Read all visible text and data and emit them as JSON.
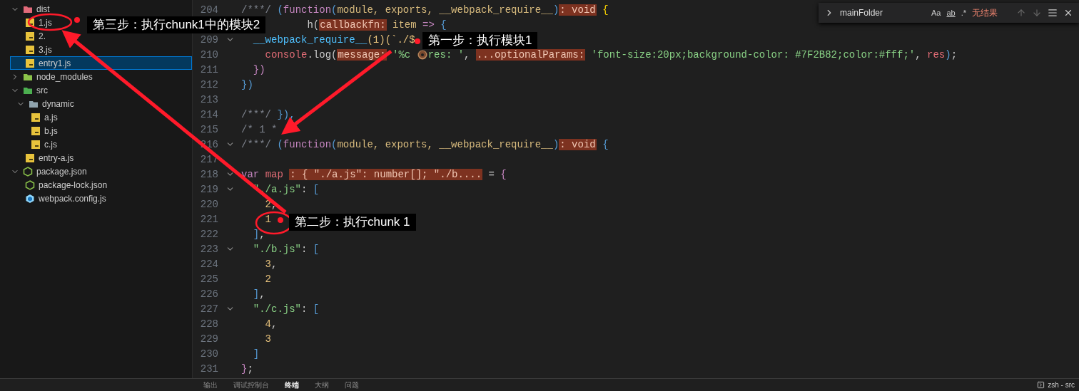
{
  "explorer": {
    "items": [
      {
        "name": "dist",
        "kind": "folder-dist",
        "expanded": true,
        "selected": false,
        "children": [
          {
            "name": "1.js",
            "kind": "js",
            "selected": false
          },
          {
            "name": "2.",
            "kind": "js",
            "selected": false
          },
          {
            "name": "3.js",
            "kind": "js",
            "selected": false
          },
          {
            "name": "entry1.js",
            "kind": "js",
            "selected": true
          }
        ]
      },
      {
        "name": "node_modules",
        "kind": "folder-node",
        "expanded": false,
        "selected": false
      },
      {
        "name": "src",
        "kind": "folder-src",
        "expanded": true,
        "selected": false,
        "children": [
          {
            "name": "dynamic",
            "kind": "folder",
            "expanded": true,
            "selected": false,
            "children": [
              {
                "name": "a.js",
                "kind": "js",
                "selected": false
              },
              {
                "name": "b.js",
                "kind": "js",
                "selected": false
              },
              {
                "name": "c.js",
                "kind": "js",
                "selected": false
              }
            ]
          },
          {
            "name": "entry-a.js",
            "kind": "js",
            "selected": false
          }
        ]
      },
      {
        "name": "package.json",
        "kind": "npm",
        "expanded": true,
        "selected": false,
        "children": [
          {
            "name": "package-lock.json",
            "kind": "npm",
            "selected": false
          },
          {
            "name": "webpack.config.js",
            "kind": "webpack",
            "selected": false
          }
        ]
      }
    ]
  },
  "editor": {
    "lines": [
      {
        "number": "204",
        "fold": false,
        "tokens": [
          {
            "text": "/***/ ",
            "kind": "comment"
          },
          {
            "text": "(",
            "kind": "paren"
          },
          {
            "text": "function",
            "kind": "keyword"
          },
          {
            "text": "(",
            "kind": "paren"
          },
          {
            "text": "module, exports, __webpack_require__",
            "kind": "param"
          },
          {
            "text": ")",
            "kind": "paren"
          },
          {
            "text": ": void",
            "kind": "hint"
          },
          {
            "text": " {",
            "kind": "brace"
          }
        ]
      },
      {
        "fold": false,
        "tokens": [
          {
            "text": "           h(",
            "kind": "plain"
          },
          {
            "text": "callbackfn:",
            "kind": "hint"
          },
          {
            "text": " item ",
            "kind": "param"
          },
          {
            "text": "=>",
            "kind": "keyword"
          },
          {
            "text": " {",
            "kind": "paren"
          }
        ]
      },
      {
        "number": "209",
        "fold": true,
        "tokens": [
          {
            "text": "  __webpack_require__",
            "kind": "fn"
          },
          {
            "text": "(1)(`./$",
            "kind": "number"
          }
        ]
      },
      {
        "number": "210",
        "fold": false,
        "tokens": [
          {
            "text": "    console",
            "kind": "var"
          },
          {
            "text": ".log(",
            "kind": "plain"
          },
          {
            "text": "message:",
            "kind": "hint"
          },
          {
            "text": " '%c ",
            "kind": "string"
          },
          {
            "kind": "donut"
          },
          {
            "text": "res: '",
            "kind": "string"
          },
          {
            "text": ", ",
            "kind": "plain"
          },
          {
            "text": "...optionalParams:",
            "kind": "hint"
          },
          {
            "text": " 'font-size:20px;background-color: #7F2B82;color:#fff;'",
            "kind": "string"
          },
          {
            "text": ", ",
            "kind": "plain"
          },
          {
            "text": "res",
            "kind": "var"
          },
          {
            "text": ")",
            "kind": "bracket"
          },
          {
            "text": ";",
            "kind": "plain"
          }
        ]
      },
      {
        "number": "211",
        "fold": false,
        "tokens": [
          {
            "text": "  })",
            "kind": "keyword"
          }
        ]
      },
      {
        "number": "212",
        "fold": false,
        "tokens": [
          {
            "text": "})",
            "kind": "bracket"
          }
        ]
      },
      {
        "number": "213",
        "fold": false
      },
      {
        "number": "214",
        "fold": false,
        "tokens": [
          {
            "text": "/***/ ",
            "kind": "comment"
          },
          {
            "text": "}),",
            "kind": "paren"
          }
        ]
      },
      {
        "number": "215",
        "fold": false,
        "tokens": [
          {
            "text": "/* 1 *",
            "kind": "comment"
          }
        ]
      },
      {
        "number": "216",
        "fold": true,
        "tokens": [
          {
            "text": "/***/ ",
            "kind": "comment"
          },
          {
            "text": "(",
            "kind": "bracket"
          },
          {
            "text": "function",
            "kind": "keyword"
          },
          {
            "text": "(",
            "kind": "paren"
          },
          {
            "text": "module, exports, __webpack_require__",
            "kind": "param"
          },
          {
            "text": ")",
            "kind": "paren"
          },
          {
            "text": ": void",
            "kind": "hint"
          },
          {
            "text": " {",
            "kind": "paren"
          }
        ]
      },
      {
        "number": "217",
        "fold": false
      },
      {
        "number": "218",
        "fold": true,
        "tokens": [
          {
            "text": "var",
            "kind": "keyword"
          },
          {
            "text": " map ",
            "kind": "var"
          },
          {
            "text": ": { \"./a.js\": number[]; \"./b....",
            "kind": "hint"
          },
          {
            "text": " = ",
            "kind": "plain"
          },
          {
            "text": "{",
            "kind": "keyword"
          }
        ]
      },
      {
        "number": "219",
        "fold": true,
        "tokens": [
          {
            "text": "  \"./a.js\"",
            "kind": "string"
          },
          {
            "text": ": ",
            "kind": "plain"
          },
          {
            "text": "[",
            "kind": "bracket"
          }
        ]
      },
      {
        "number": "220",
        "fold": false,
        "tokens": [
          {
            "text": "    2",
            "kind": "number"
          },
          {
            "text": ",",
            "kind": "plain"
          }
        ]
      },
      {
        "number": "221",
        "fold": false,
        "tokens": [
          {
            "text": "    1",
            "kind": "number"
          }
        ]
      },
      {
        "number": "222",
        "fold": false,
        "tokens": [
          {
            "text": "  ]",
            "kind": "bracket"
          },
          {
            "text": ",",
            "kind": "plain"
          }
        ]
      },
      {
        "number": "223",
        "fold": true,
        "tokens": [
          {
            "text": "  \"./b.js\"",
            "kind": "string"
          },
          {
            "text": ": ",
            "kind": "plain"
          },
          {
            "text": "[",
            "kind": "bracket"
          }
        ]
      },
      {
        "number": "224",
        "fold": false,
        "tokens": [
          {
            "text": "    3",
            "kind": "number"
          },
          {
            "text": ",",
            "kind": "plain"
          }
        ]
      },
      {
        "number": "225",
        "fold": false,
        "tokens": [
          {
            "text": "    2",
            "kind": "number"
          }
        ]
      },
      {
        "number": "226",
        "fold": false,
        "tokens": [
          {
            "text": "  ]",
            "kind": "bracket"
          },
          {
            "text": ",",
            "kind": "plain"
          }
        ]
      },
      {
        "number": "227",
        "fold": true,
        "tokens": [
          {
            "text": "  \"./c.js\"",
            "kind": "string"
          },
          {
            "text": ": ",
            "kind": "plain"
          },
          {
            "text": "[",
            "kind": "bracket"
          }
        ]
      },
      {
        "number": "228",
        "fold": false,
        "tokens": [
          {
            "text": "    4",
            "kind": "number"
          },
          {
            "text": ",",
            "kind": "plain"
          }
        ]
      },
      {
        "number": "229",
        "fold": false,
        "tokens": [
          {
            "text": "    3",
            "kind": "number"
          }
        ]
      },
      {
        "number": "230",
        "fold": false,
        "tokens": [
          {
            "text": "  ]",
            "kind": "bracket"
          }
        ]
      },
      {
        "number": "231",
        "fold": false,
        "tokens": [
          {
            "text": "}",
            "kind": "keyword"
          },
          {
            "text": ";",
            "kind": "plain"
          }
        ]
      }
    ]
  },
  "find_widget": {
    "value": "mainFolder",
    "toggles": [
      "Aa",
      "ab",
      ".*"
    ],
    "result": "无结果"
  },
  "panel": {
    "tabs": [
      {
        "label": "输出",
        "selected": false
      },
      {
        "label": "调试控制台",
        "selected": false
      },
      {
        "label": "终端",
        "selected": true
      },
      {
        "label": "大纲",
        "selected": false
      },
      {
        "label": "问题",
        "selected": false
      }
    ],
    "terminal": "zsh - src"
  },
  "annotations": [
    {
      "text": "第三步：执行chunk1中的模块2"
    },
    {
      "text": "第一步：执行模块1"
    },
    {
      "text": "第二步：执行chunk 1"
    }
  ]
}
